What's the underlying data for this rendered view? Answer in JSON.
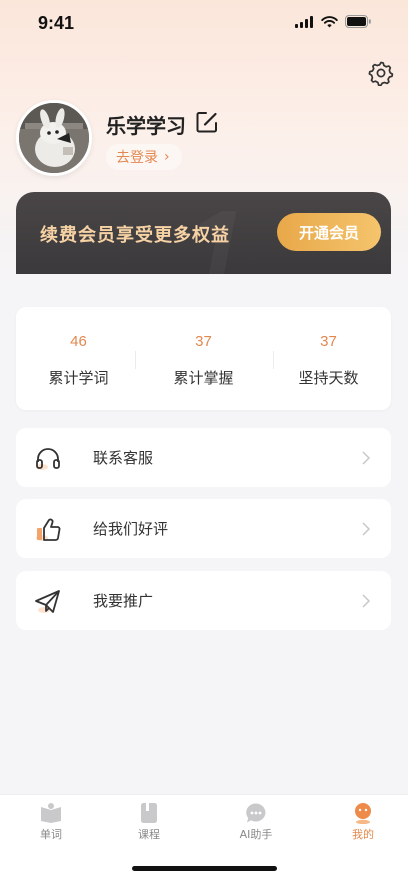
{
  "status_bar": {
    "time": "9:41"
  },
  "profile": {
    "username": "乐学学习",
    "login_label": "去登录",
    "login_chevron": "›"
  },
  "vip": {
    "text": "续费会员享受更多权益",
    "button_label": "开通会员",
    "deco_glyph": "1"
  },
  "stats": [
    {
      "value": "46",
      "label": "累计学词"
    },
    {
      "value": "37",
      "label": "累计掌握"
    },
    {
      "value": "37",
      "label": "坚持天数"
    }
  ],
  "menu": [
    {
      "label": "联系客服",
      "icon": "headset-icon"
    },
    {
      "label": "给我们好评",
      "icon": "thumbs-up-icon"
    },
    {
      "label": "我要推广",
      "icon": "paper-plane-icon"
    }
  ],
  "tabs": [
    {
      "label": "单词",
      "icon": "book-icon",
      "active": false
    },
    {
      "label": "课程",
      "icon": "notebook-icon",
      "active": false
    },
    {
      "label": "AI助手",
      "icon": "chat-bubble-icon",
      "active": false
    },
    {
      "label": "我的",
      "icon": "profile-icon",
      "active": true
    }
  ],
  "colors": {
    "accent": "#e2884f",
    "vip_text": "#f6d2a4",
    "vip_button": "#eeb45a"
  }
}
